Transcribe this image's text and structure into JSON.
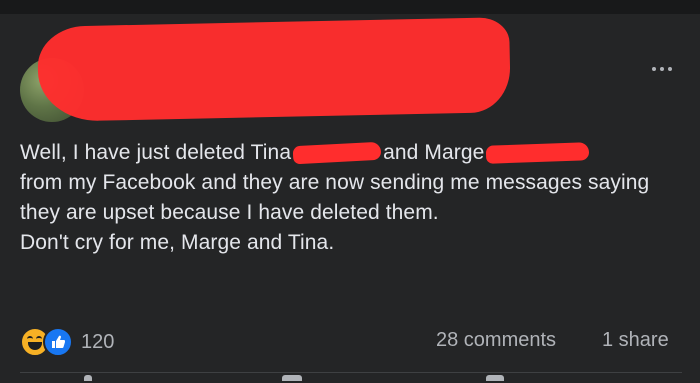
{
  "post": {
    "body_parts": [
      "Well, I have just deleted Tina",
      "and Marge",
      "from my Facebook and they are now sending me messages saying they are upset because I have deleted them.",
      "Don't cry for me, Marge and Tina."
    ],
    "reactions": {
      "count": "120",
      "icons": [
        "haha-icon",
        "like-icon"
      ]
    },
    "comments_label": "28 comments",
    "shares_label": "1 share"
  },
  "colors": {
    "background": "#242526",
    "text": "#e4e6eb",
    "secondary_text": "#b0b3b8",
    "redaction": "#ff2d2d",
    "like_blue": "#1877f2",
    "haha_yellow": "#f7b125"
  }
}
